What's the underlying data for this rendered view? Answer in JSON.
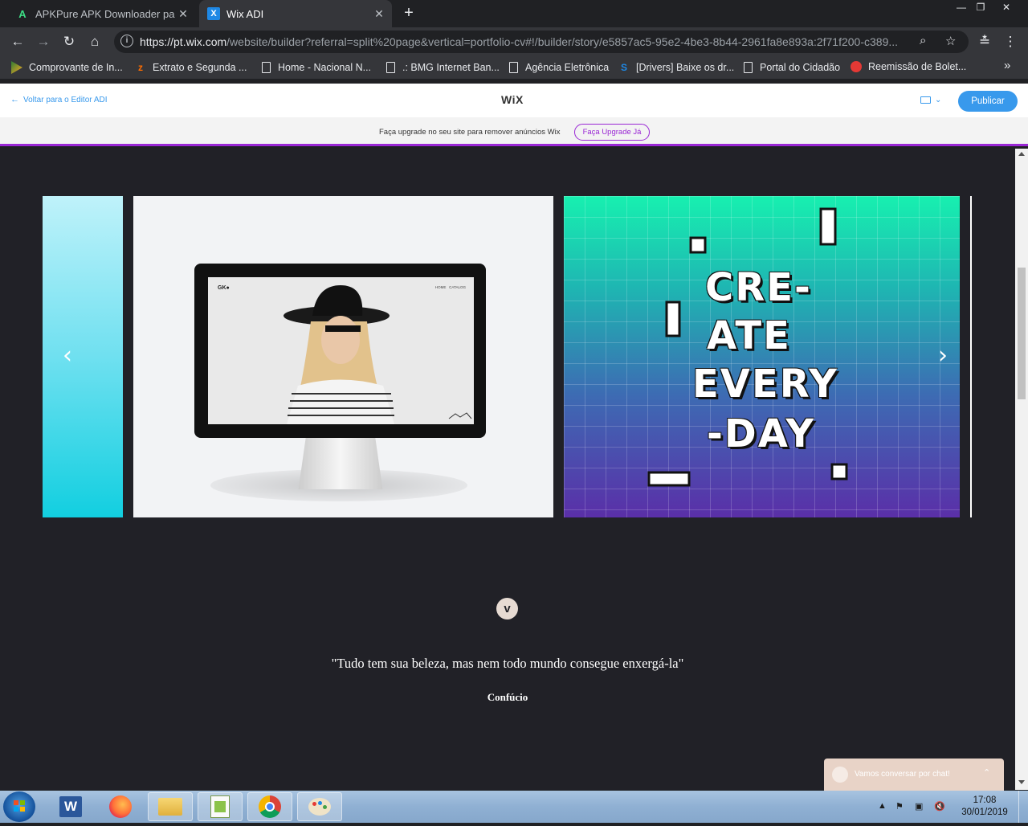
{
  "browser": {
    "tabs": [
      {
        "title": "APKPure APK Downloader para A",
        "favicon": "apkpure-icon",
        "active": false
      },
      {
        "title": "Wix ADI",
        "favicon": "wix-icon",
        "active": true
      }
    ],
    "new_tab": "+",
    "window_controls": {
      "minimize": "—",
      "restore": "❐",
      "close": "✕"
    },
    "url": {
      "host": "https://pt.wix.com",
      "path": "/website/builder?referral=split%20page&vertical=portfolio-cv#!/builder/story/e5857ac5-95e2-4be3-8b44-2961fa8e893a:2f71f200-c389..."
    },
    "bookmarks": [
      {
        "label": "Comprovante de In...",
        "icon": "bookmark-app-icon"
      },
      {
        "label": "Extrato e Segunda ...",
        "icon": "bookmark-app-icon"
      },
      {
        "label": "Home - Nacional N...",
        "icon": "page-icon"
      },
      {
        "label": ".: BMG Internet Ban...",
        "icon": "page-icon"
      },
      {
        "label": "Agência Eletrônica",
        "icon": "page-icon"
      },
      {
        "label": "[Drivers] Baixe os dr...",
        "icon": "s-icon"
      },
      {
        "label": "Portal do Cidadão",
        "icon": "page-icon"
      },
      {
        "label": "Reemissão de Bolet...",
        "icon": "santander-icon"
      }
    ],
    "bookmarks_overflow": "»"
  },
  "wix": {
    "back_label": "Voltar para o Editor ADI",
    "logo": "WiX",
    "publish_label": "Publicar",
    "upgrade_text": "Faça upgrade no seu site para remover anúncios Wix",
    "upgrade_button": "Faça Upgrade Já"
  },
  "site": {
    "mockup_brand": "GK●",
    "mockup_nav": "HOME   CATALOG",
    "art_lines": [
      "CRE-",
      "ATE",
      "EVERY",
      "-DAY"
    ],
    "quote": "\"Tudo tem sua beleza, mas nem todo mundo consegue enxergá-la\"",
    "author": "Confúcio",
    "quote_icon_letter": "v",
    "chat_label": "Vamos conversar por chat!"
  },
  "taskbar": {
    "apps": [
      "word-icon",
      "firefox-icon",
      "file-explorer-icon",
      "notepad-plus-plus-icon",
      "chrome-icon",
      "paint-icon"
    ],
    "time": "17:08",
    "date": "30/01/2019"
  },
  "colors": {
    "wix_blue": "#3899ec",
    "upgrade_purple": "#9a27d5",
    "site_bg": "#212127"
  }
}
